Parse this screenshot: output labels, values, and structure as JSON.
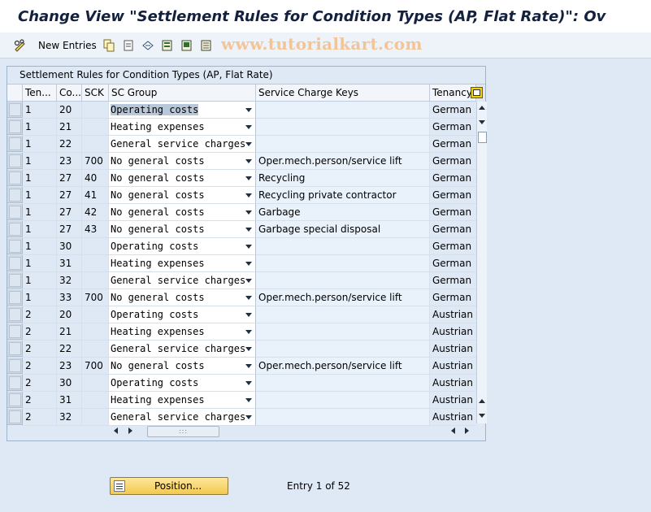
{
  "window": {
    "title": "Change View \"Settlement Rules for Condition Types (AP, Flat Rate)\": Ov"
  },
  "toolbar": {
    "new_entries_label": "New Entries",
    "watermark": "www.tutorialkart.com",
    "icons": [
      "glasses-pencil-icon",
      "copy-icon",
      "delete-icon",
      "undo-icon",
      "select-all-icon",
      "select-block-icon",
      "deselect-all-icon"
    ]
  },
  "table": {
    "title": "Settlement Rules for Condition Types (AP, Flat Rate)",
    "columns": [
      "Ten...",
      "Co...",
      "SCK",
      "SC Group",
      "Service Charge Keys",
      "Tenancy"
    ],
    "rows": [
      [
        "1",
        "20",
        "",
        "Operating costs",
        "",
        "German"
      ],
      [
        "1",
        "21",
        "",
        "Heating expenses",
        "",
        "German"
      ],
      [
        "1",
        "22",
        "",
        "General service charges",
        "",
        "German"
      ],
      [
        "1",
        "23",
        "700",
        "No general costs",
        "Oper.mech.person/service lift",
        "German"
      ],
      [
        "1",
        "27",
        "40",
        "No general costs",
        "Recycling",
        "German"
      ],
      [
        "1",
        "27",
        "41",
        "No general costs",
        "Recycling private contractor",
        "German"
      ],
      [
        "1",
        "27",
        "42",
        "No general costs",
        "Garbage",
        "German"
      ],
      [
        "1",
        "27",
        "43",
        "No general costs",
        "Garbage special disposal",
        "German"
      ],
      [
        "1",
        "30",
        "",
        "Operating costs",
        "",
        "German"
      ],
      [
        "1",
        "31",
        "",
        "Heating expenses",
        "",
        "German"
      ],
      [
        "1",
        "32",
        "",
        "General service charges",
        "",
        "German"
      ],
      [
        "1",
        "33",
        "700",
        "No general costs",
        "Oper.mech.person/service lift",
        "German"
      ],
      [
        "2",
        "20",
        "",
        "Operating costs",
        "",
        "Austrian"
      ],
      [
        "2",
        "21",
        "",
        "Heating expenses",
        "",
        "Austrian"
      ],
      [
        "2",
        "22",
        "",
        "General service charges",
        "",
        "Austrian"
      ],
      [
        "2",
        "23",
        "700",
        "No general costs",
        "Oper.mech.person/service lift",
        "Austrian"
      ],
      [
        "2",
        "30",
        "",
        "Operating costs",
        "",
        "Austrian"
      ],
      [
        "2",
        "31",
        "",
        "Heating expenses",
        "",
        "Austrian"
      ],
      [
        "2",
        "32",
        "",
        "General service charges",
        "",
        "Austrian"
      ]
    ]
  },
  "footer": {
    "position_button_label": "Position...",
    "entry_info": "Entry 1 of 52"
  },
  "colors": {
    "title": "#13213f",
    "background": "#dfe9f5",
    "button": "#f3c94f",
    "watermark": "#f2c49a"
  }
}
